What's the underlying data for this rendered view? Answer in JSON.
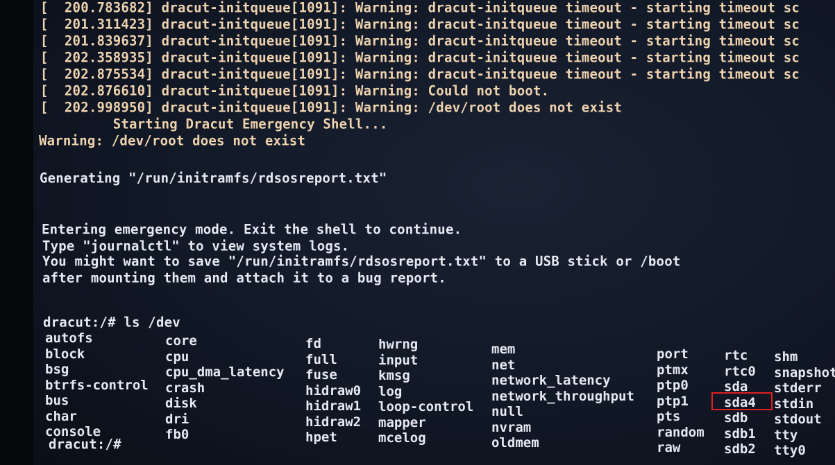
{
  "log_lines": [
    "[  200.783682] dracut-initqueue[1091]: Warning: dracut-initqueue timeout - starting timeout sc",
    "[  201.311423] dracut-initqueue[1091]: Warning: dracut-initqueue timeout - starting timeout sc",
    "[  201.839637] dracut-initqueue[1091]: Warning: dracut-initqueue timeout - starting timeout sc",
    "[  202.358935] dracut-initqueue[1091]: Warning: dracut-initqueue timeout - starting timeout sc",
    "[  202.875534] dracut-initqueue[1091]: Warning: dracut-initqueue timeout - starting timeout sc",
    "[  202.876610] dracut-initqueue[1091]: Warning: Could not boot.",
    "[  202.998950] dracut-initqueue[1091]: Warning: /dev/root does not exist",
    "         Starting Dracut Emergency Shell...",
    "Warning: /dev/root does not exist"
  ],
  "messages": [
    "Generating \"/run/initramfs/rdsosreport.txt\"",
    "Entering emergency mode. Exit the shell to continue.",
    "Type \"journalctl\" to view system logs.",
    "You might want to save \"/run/initramfs/rdsosreport.txt\" to a USB stick or /boot",
    "after mounting them and attach it to a bug report."
  ],
  "command": "dracut:/# ls /dev",
  "prompt": "dracut:/#",
  "ls_columns": [
    [
      "autofs",
      "block",
      "bsg",
      "btrfs-control",
      "bus",
      "char",
      "console"
    ],
    [
      "core",
      "cpu",
      "cpu_dma_latency",
      "crash",
      "disk",
      "dri",
      "fb0"
    ],
    [
      "fd",
      "full",
      "fuse",
      "hidraw0",
      "hidraw1",
      "hidraw2",
      "hpet"
    ],
    [
      "hwrng",
      "input",
      "kmsg",
      "log",
      "loop-control",
      "mapper",
      "mcelog"
    ],
    [
      "mem",
      "net",
      "network_latency",
      "network_throughput",
      "null",
      "nvram",
      "oldmem"
    ],
    [
      "port",
      "ptmx",
      "ptp0",
      "ptp1",
      "pts",
      "random",
      "raw"
    ],
    [
      "rtc",
      "rtc0",
      "sda",
      "sda4",
      "sdb",
      "sdb1",
      "sdb2"
    ],
    [
      "shm",
      "snapshot",
      "stderr",
      "stdin",
      "stdout",
      "tty",
      "tty0"
    ]
  ],
  "highlighted_entry": "sda4",
  "colors": {
    "log_text": "#efd2ae",
    "shell_text": "#e6e8f2",
    "highlight_box": "#e02020",
    "background": "#111826"
  }
}
